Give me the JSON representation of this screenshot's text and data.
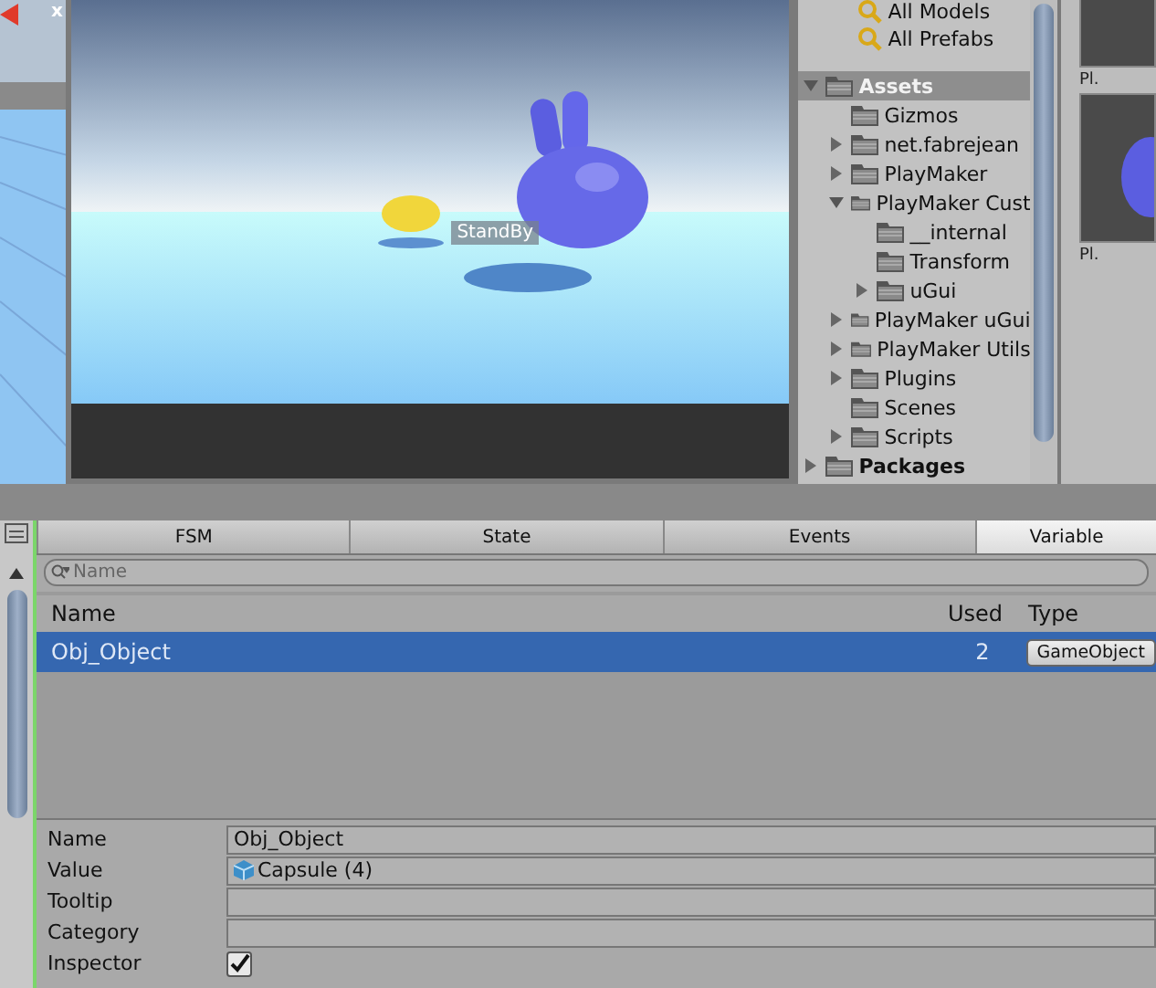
{
  "scene_view": {
    "axis_label": "x"
  },
  "game_view": {
    "object_label": "StandBy"
  },
  "project": {
    "favorites": [
      "All Models",
      "All Prefabs"
    ],
    "tree": [
      {
        "label": "Assets",
        "expanded": true,
        "selected": true,
        "children": [
          {
            "label": "Gizmos",
            "selected": false
          },
          {
            "label": "net.fabrejean",
            "expanded": false,
            "selected": false
          },
          {
            "label": "PlayMaker",
            "expanded": false,
            "selected": false
          },
          {
            "label": "PlayMaker Cust",
            "expanded": true,
            "selected": false,
            "children": [
              {
                "label": "__internal",
                "selected": false
              },
              {
                "label": "Transform",
                "selected": false
              },
              {
                "label": "uGui",
                "expanded": false,
                "selected": false
              }
            ]
          },
          {
            "label": "PlayMaker uGui",
            "expanded": false,
            "selected": false
          },
          {
            "label": "PlayMaker Utils",
            "expanded": false,
            "selected": false
          },
          {
            "label": "Plugins",
            "expanded": false,
            "selected": false
          },
          {
            "label": "Scenes",
            "selected": false
          },
          {
            "label": "Scripts",
            "expanded": false,
            "selected": false
          }
        ]
      },
      {
        "label": "Packages",
        "expanded": false,
        "selected": false
      }
    ]
  },
  "preview_labels": [
    "Pl.",
    "Pl."
  ],
  "fsm": {
    "tabs": [
      {
        "label": "FSM",
        "selected": false
      },
      {
        "label": "State",
        "selected": false
      },
      {
        "label": "Events",
        "selected": false
      },
      {
        "label": "Variable",
        "selected": true
      }
    ],
    "search": {
      "placeholder": "Name"
    },
    "columns": [
      "Name",
      "Used",
      "Type"
    ],
    "rows": [
      {
        "name": "Obj_Object",
        "used": "2",
        "type": "GameObject",
        "selected": true
      }
    ],
    "properties": [
      {
        "label": "Name",
        "kind": "text",
        "value": "Obj_Object"
      },
      {
        "label": "Value",
        "kind": "object",
        "value": "Capsule (4)"
      },
      {
        "label": "Tooltip",
        "kind": "text"
      },
      {
        "label": "Category",
        "kind": "text"
      },
      {
        "label": "Inspector",
        "kind": "checkbox",
        "checked": true
      }
    ]
  }
}
